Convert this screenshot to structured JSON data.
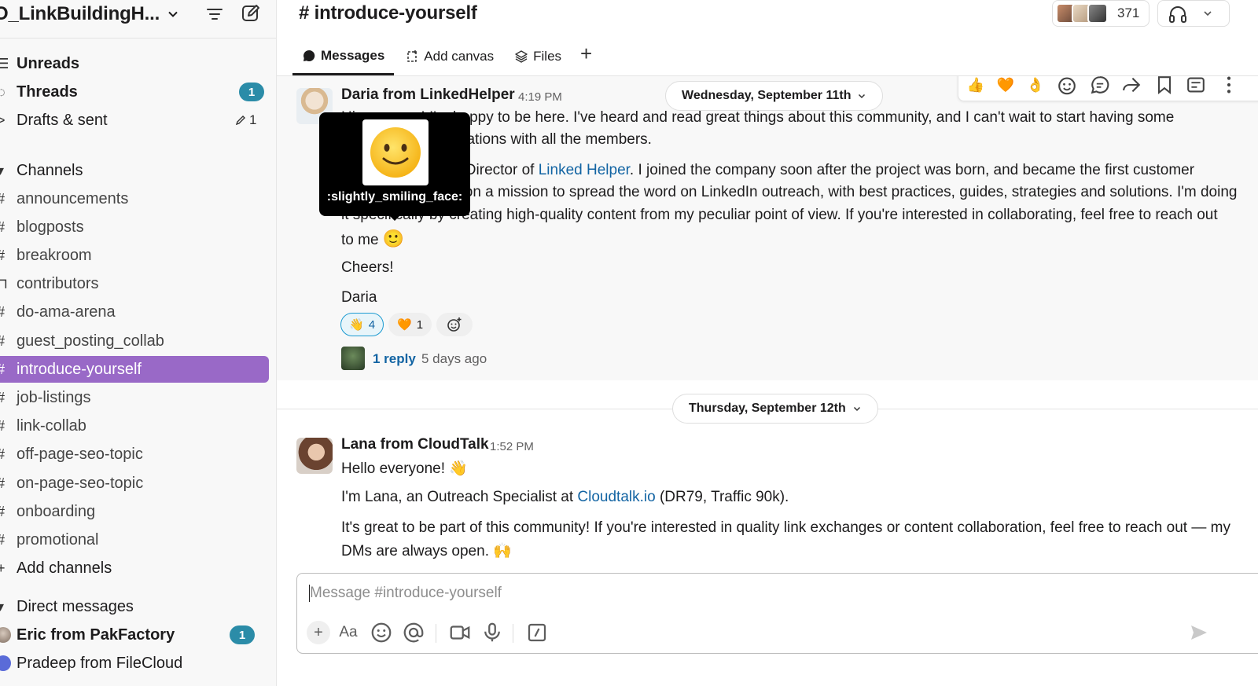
{
  "workspace": {
    "name": "O_LinkBuildingH..."
  },
  "sidebar": {
    "unreads": "Unreads",
    "threads": "Threads",
    "threads_badge": "1",
    "drafts": "Drafts & sent",
    "drafts_count": "1",
    "channels_header": "Channels",
    "channels": [
      "announcements",
      "blogposts",
      "breakroom",
      "contributors",
      "do-ama-arena",
      "guest_posting_collab",
      "introduce-yourself",
      "job-listings",
      "link-collab",
      "off-page-seo-topic",
      "on-page-seo-topic",
      "onboarding",
      "promotional"
    ],
    "active_channel": "introduce-yourself",
    "add_channels": "Add channels",
    "dm_header": "Direct messages",
    "dms": [
      {
        "name": "Eric from PakFactory",
        "badge": "1",
        "unread": true
      },
      {
        "name": "Pradeep from FileCloud",
        "unread": false
      }
    ]
  },
  "header": {
    "channel_title": "# introduce-yourself",
    "member_count": "371",
    "tabs": {
      "messages": "Messages",
      "add_canvas": "Add canvas",
      "files": "Files"
    }
  },
  "messages": [
    {
      "sender": "Daria from LinkedHelper",
      "time": "4:19 PM",
      "lines": [
        "Hi everyone! I'm happy to be here. I've heard and read great things about this community, and I can't wait to start having some",
        "interesting conversations with all the members.",
        "I'm Daria, Content Director of ",
        "Linked Helper",
        ". I joined the company soon after the project was born, and became the first customer",
        "support agent. I'm on a mission to spread the word on LinkedIn outreach, with best practices, guides, strategies and solutions. I'm doing",
        "it specifically by creating high-quality content from my peculiar point of view. If you're interested in collaborating, feel free to reach out",
        "to me"
      ],
      "cheers": "Cheers!",
      "signoff": "Daria",
      "reactions": [
        {
          "emoji": "👋",
          "count": "4",
          "mine": true
        },
        {
          "emoji": "🧡",
          "count": "1",
          "mine": false
        }
      ],
      "reply_count": "1 reply",
      "reply_time": "5 days ago"
    },
    {
      "sender": "Lana from CloudTalk",
      "time": "1:52 PM",
      "greeting": "Hello everyone! 👋",
      "intro_a": "I'm Lana, an Outreach Specialist at ",
      "intro_link": "Cloudtalk.io",
      "intro_b": " (DR79, Traffic 90k).",
      "body_1": "It's great to be part of this community! If you're interested in quality link exchanges or content collaboration, feel free to reach out — my",
      "body_2": "DMs are always open. 🙌"
    }
  ],
  "date_dividers": {
    "first": "Wednesday, September 11th",
    "second": "Thursday, September 12th"
  },
  "tooltip": {
    "label": ":slightly_smiling_face:",
    "emoji": "🙂"
  },
  "action_bar": [
    "👍",
    "🧡",
    "👌"
  ],
  "composer": {
    "placeholder": "Message #introduce-yourself"
  },
  "colors": {
    "active_channel": "#9969c7",
    "badge": "#2b8ca8",
    "link": "#1264a3"
  }
}
